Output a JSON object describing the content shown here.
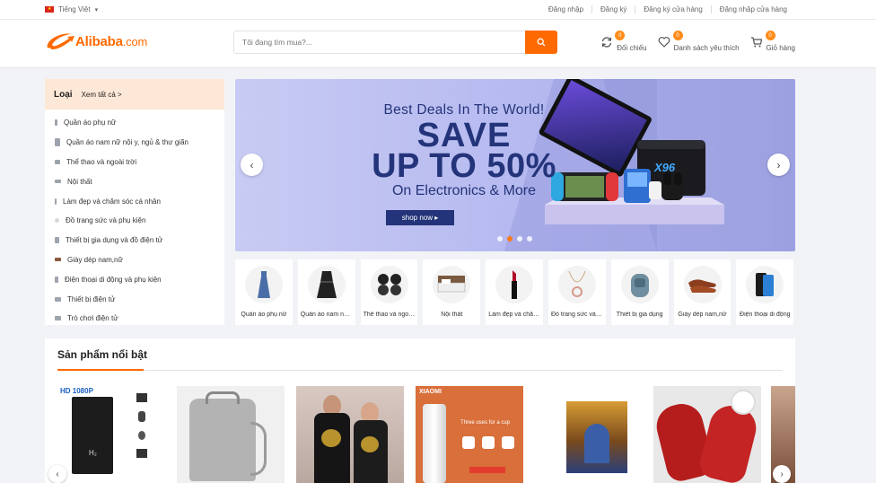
{
  "topbar": {
    "language": "Tiếng Việt",
    "links": [
      "Đăng nhập",
      "Đăng ký",
      "Đăng ký cửa hàng",
      "Đăng nhập cửa hàng"
    ]
  },
  "header": {
    "logo_text": "Alibaba",
    "logo_suffix": ".com",
    "search_placeholder": "Tôi đang tìm mua?...",
    "compare": {
      "label": "Đối chiếu",
      "count": "0"
    },
    "wishlist": {
      "label": "Danh sách yêu thích",
      "count": "0"
    },
    "cart": {
      "label": "Giỏ hàng",
      "count": "0"
    }
  },
  "categories": {
    "title": "Loại",
    "view_all": "Xem tất cả >",
    "items": [
      "Quần áo phụ nữ",
      "Quần áo nam nữ nội y, ngủ & thư giãn",
      "Thể thao và ngoài trời",
      "Nội thất",
      "Làm đẹp và chăm sóc cá nhân",
      "Đồ trang sức và phụ kiện",
      "Thiết bị gia dụng và đồ điện tử",
      "Giày dép nam,nữ",
      "Điện thoại di động và phụ kiện",
      "Thiết bị điện tử",
      "Trò chơi điện tử"
    ]
  },
  "banner": {
    "line1": "Best Deals In The World!",
    "line2": "SAVE",
    "line3": "UP TO 50%",
    "line4": "On Electronics & More",
    "button": "shop now ▸",
    "device_label": "X96",
    "slides": 4,
    "active_slide": 2
  },
  "strip": {
    "items": [
      "Quần áo phụ nữ",
      "Quần áo nam nữ nội y",
      "Thể thao và ngoài trời",
      "Nội thất",
      "Làm đẹp và chăm sóc",
      "Đồ trang sức và phụ kiện",
      "Thiết bị gia dụng",
      "Giày dép nam,nữ",
      "Điện thoại di động"
    ]
  },
  "featured": {
    "title": "Sản phẩm nổi bật",
    "product1_badge": "HD 1080P",
    "product1_brand": "H₂",
    "product4_brand": "XIAOMI",
    "product4_caption": "Three uses for a cup"
  },
  "colors": {
    "accent": "#ff6a00",
    "banner_text": "#24347a",
    "badge": "#ff8c1a"
  }
}
